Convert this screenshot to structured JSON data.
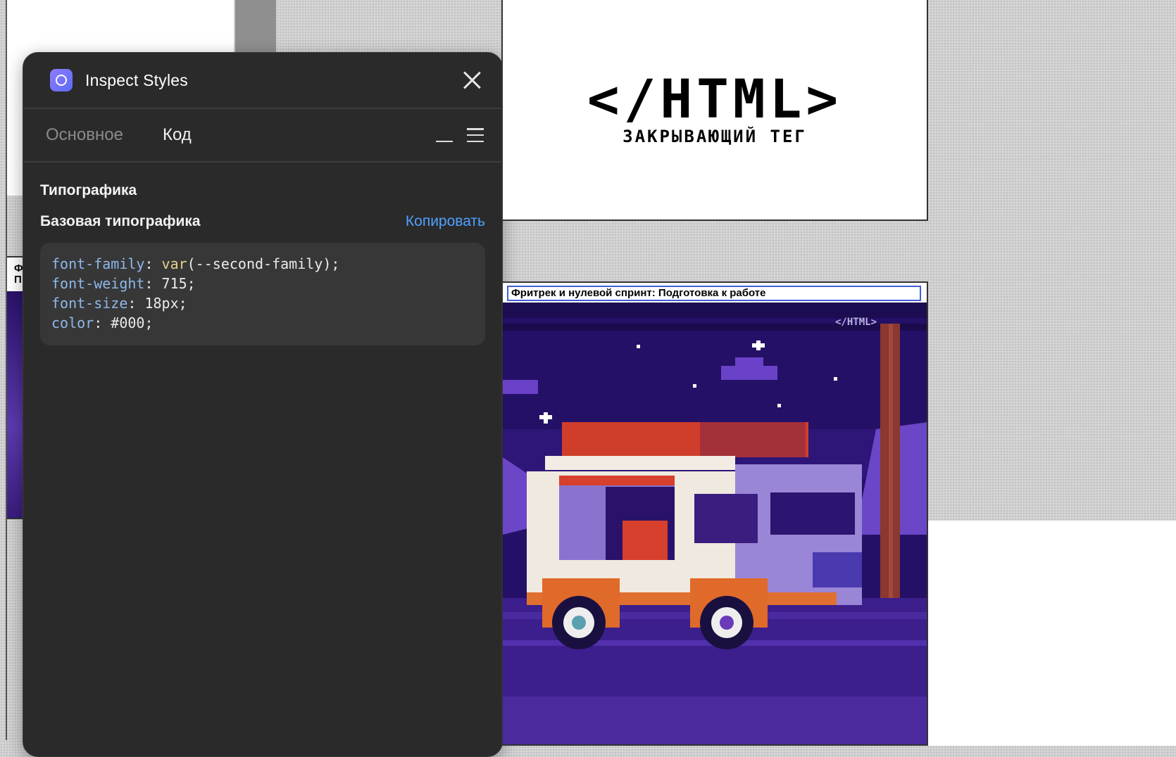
{
  "panel": {
    "title": "Inspect Styles",
    "tabs": [
      {
        "label": "Основное",
        "active": false
      },
      {
        "label": "Код",
        "active": true
      }
    ],
    "section_title": "Типографика",
    "subsection_title": "Базовая типографика",
    "copy_label": "Копировать",
    "code": {
      "l1_prop": "font-family",
      "l1_fn": "var",
      "l1_rest": "(--second-family);",
      "l2_prop": "font-weight",
      "l2_val": " 715;",
      "l3_prop": "font-size",
      "l3_val": " 18px;",
      "l4_prop": "color",
      "l4_val": " #000;"
    }
  },
  "logo_card": {
    "logo": "</HTML>",
    "subtitle": "ЗАКРЫВАЮЩИЙ ТЕГ"
  },
  "video_card": {
    "title": "Фритрек и нулевой спринт: Подготовка к работе",
    "watermark": "</HTML>"
  },
  "left_fragment": {
    "line1": "Ф",
    "line2": "П"
  },
  "colors": {
    "panel_bg": "#2a2a2b",
    "accent_link": "#4ea1ff",
    "night_sky": "#241067"
  }
}
